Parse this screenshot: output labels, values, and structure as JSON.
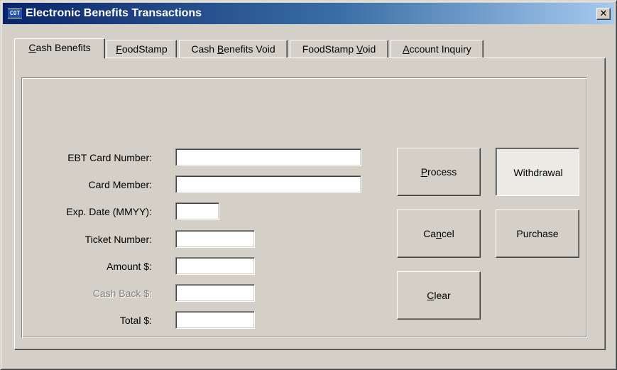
{
  "window": {
    "title": "Electronic Benefits Transactions",
    "icon_text": "COT",
    "close_symbol": "✕"
  },
  "tabs": [
    {
      "label": "Cash Benefits",
      "hotkey": "C",
      "active": true
    },
    {
      "label": "FoodStamp",
      "hotkey": "F",
      "active": false
    },
    {
      "label": "Cash Benefits Void",
      "hotkey": "B",
      "active": false
    },
    {
      "label": "FoodStamp Void",
      "hotkey": "V",
      "active": false
    },
    {
      "label": "Account Inquiry",
      "hotkey": "A",
      "active": false
    }
  ],
  "form": {
    "fields": [
      {
        "label": "EBT Card Number:",
        "value": "",
        "enabled": true
      },
      {
        "label": "Card Member:",
        "value": "",
        "enabled": true
      },
      {
        "label": "Exp. Date (MMYY):",
        "value": "",
        "enabled": true
      },
      {
        "label": "Ticket Number:",
        "value": "",
        "enabled": true
      },
      {
        "label": "Amount $:",
        "value": "",
        "enabled": true
      },
      {
        "label": "Cash Back $:",
        "value": "",
        "enabled": false
      },
      {
        "label": "Total $:",
        "value": "",
        "enabled": true
      }
    ]
  },
  "buttons": {
    "process": {
      "pre": "",
      "hot": "P",
      "post": "rocess"
    },
    "withdrawal": {
      "label": "Withdrawal",
      "pressed": true
    },
    "cancel": {
      "pre": "Ca",
      "hot": "n",
      "post": "cel"
    },
    "purchase": {
      "label": "Purchase"
    },
    "clear": {
      "pre": "",
      "hot": "C",
      "post": "lear"
    }
  },
  "colors": {
    "face": "#d4d0c8",
    "titlebar_start": "#0a246a",
    "titlebar_end": "#a6caf0",
    "disabled_text": "#808080"
  }
}
